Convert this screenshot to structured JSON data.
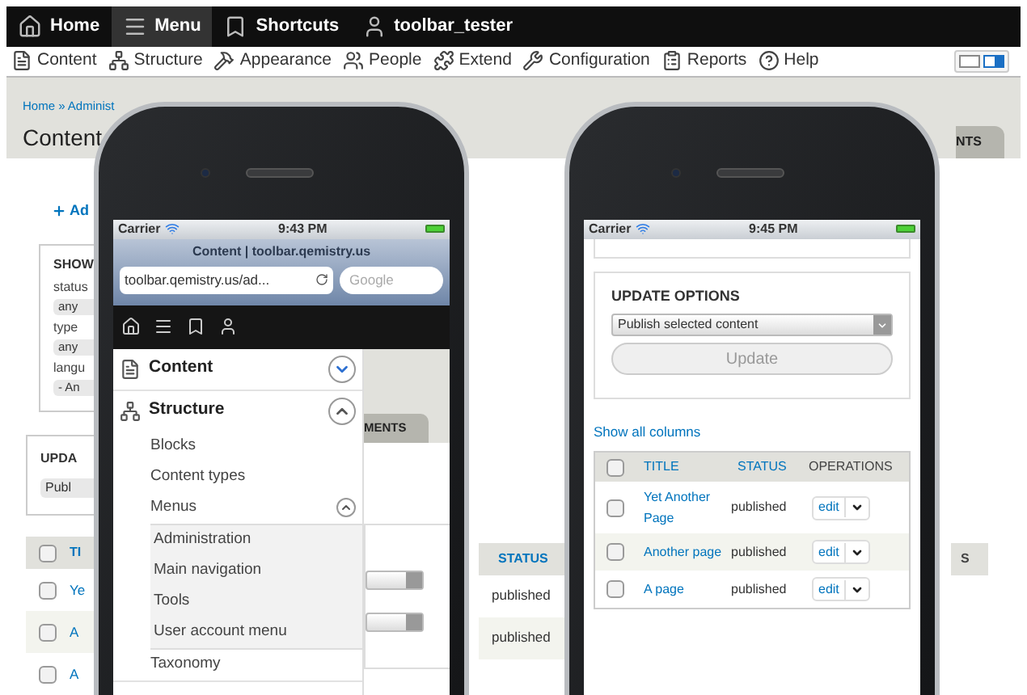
{
  "toolbar": {
    "items": [
      {
        "label": "Home",
        "selected": false
      },
      {
        "label": "Menu",
        "selected": true
      },
      {
        "label": "Shortcuts",
        "selected": false
      },
      {
        "label": "toolbar_tester",
        "selected": false
      }
    ]
  },
  "tray": {
    "items": [
      {
        "label": "Content"
      },
      {
        "label": "Structure"
      },
      {
        "label": "Appearance"
      },
      {
        "label": "People"
      },
      {
        "label": "Extend"
      },
      {
        "label": "Configuration"
      },
      {
        "label": "Reports"
      },
      {
        "label": "Help"
      }
    ]
  },
  "page": {
    "breadcrumb": "Home » Administ",
    "title": "Content",
    "add_link": "Ad",
    "right_tab": "NTS",
    "filters": {
      "legend": "SHOW",
      "fields": [
        {
          "label": "status",
          "value": "any"
        },
        {
          "label": "type",
          "value": "any"
        },
        {
          "label": "langu",
          "value": "- An"
        }
      ]
    },
    "update": {
      "legend": "UPDA",
      "value": "Publ"
    },
    "table": {
      "columns": [
        "TI",
        "STATUS",
        "S"
      ],
      "header_checked": false,
      "rows": [
        {
          "title": "Ye",
          "status": "published",
          "checked": false
        },
        {
          "title": "A",
          "status": "published",
          "checked": false
        },
        {
          "title": "A",
          "checked": false
        }
      ]
    }
  },
  "left_phone": {
    "carrier": "Carrier",
    "time": "9:43 PM",
    "browser_title": "Content | toolbar.qemistry.us",
    "url": "toolbar.qemistry.us/ad...",
    "search": {
      "placeholder": "Google"
    },
    "page_tab": "MENTS",
    "menu": [
      {
        "label": "Content",
        "expanded": false
      },
      {
        "label": "Structure",
        "expanded": true,
        "children": [
          {
            "label": "Blocks"
          },
          {
            "label": "Content types"
          },
          {
            "label": "Menus",
            "expanded": true,
            "children": [
              {
                "label": "Administration"
              },
              {
                "label": "Main navigation"
              },
              {
                "label": "Tools"
              },
              {
                "label": "User account menu"
              }
            ]
          },
          {
            "label": "Taxonomy"
          }
        ]
      }
    ]
  },
  "right_phone": {
    "carrier": "Carrier",
    "time": "9:45 PM",
    "update": {
      "legend": "UPDATE OPTIONS",
      "select": "Publish selected content",
      "button": "Update",
      "disabled": true
    },
    "show_all": "Show all columns",
    "table": {
      "columns": [
        "TITLE",
        "STATUS",
        "OPERATIONS"
      ],
      "header_checked": false,
      "rows": [
        {
          "title": "Yet Another Page",
          "status": "published",
          "operation": "edit",
          "checked": false
        },
        {
          "title": "Another page",
          "status": "published",
          "operation": "edit",
          "checked": false
        },
        {
          "title": "A page",
          "status": "published",
          "operation": "edit",
          "checked": false
        }
      ]
    }
  }
}
